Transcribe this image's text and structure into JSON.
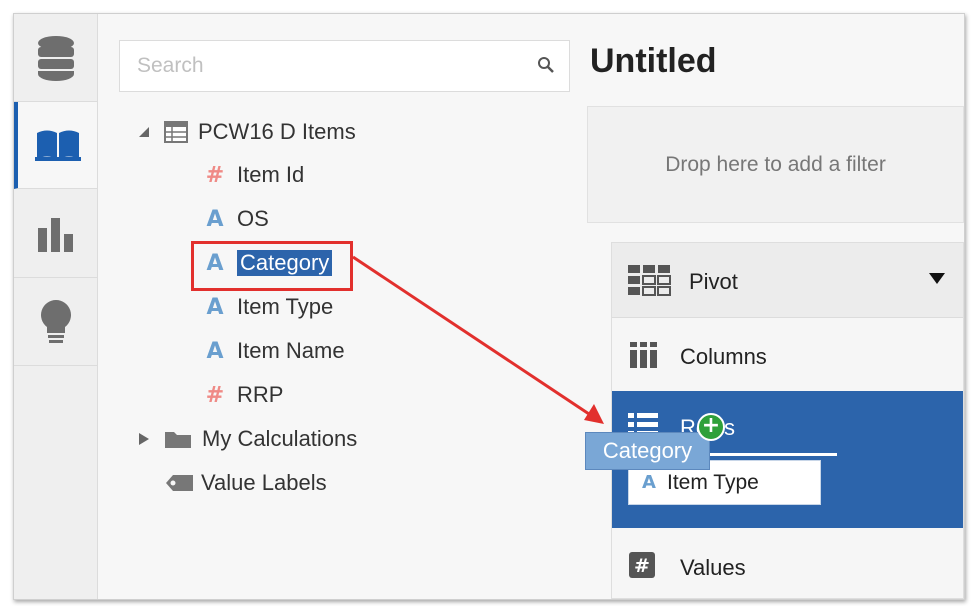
{
  "search": {
    "placeholder": "Search"
  },
  "tree": {
    "root": {
      "label": "PCW16 D Items",
      "icon": "subject-area-icon"
    },
    "columns": [
      {
        "label": "Item Id",
        "type": "numeric",
        "glyph": "#"
      },
      {
        "label": "OS",
        "type": "text",
        "glyph": "A"
      },
      {
        "label": "Category",
        "type": "text",
        "glyph": "A",
        "selected": true
      },
      {
        "label": "Item Type",
        "type": "text",
        "glyph": "A"
      },
      {
        "label": "Item Name",
        "type": "text",
        "glyph": "A"
      },
      {
        "label": "RRP",
        "type": "numeric",
        "glyph": "#"
      }
    ],
    "folders": [
      {
        "label": "My Calculations",
        "icon": "folder-icon"
      },
      {
        "label": "Value Labels",
        "icon": "tag-icon"
      }
    ]
  },
  "canvas": {
    "title": "Untitled",
    "filter_drop": "Drop here to add a filter"
  },
  "pivot": {
    "title": "Pivot",
    "columns_label": "Columns",
    "rows_label": "Rows",
    "rows_item": "Item Type",
    "values_label": "Values"
  },
  "drag": {
    "chip_label": "Category",
    "plus": "+"
  },
  "colors": {
    "accent_blue": "#2c64ab",
    "text_glyph": "#6a9fcf",
    "numeric_glyph": "#ef8a86",
    "annotation_red": "#e2302d",
    "drop_green": "#2fa03a"
  }
}
